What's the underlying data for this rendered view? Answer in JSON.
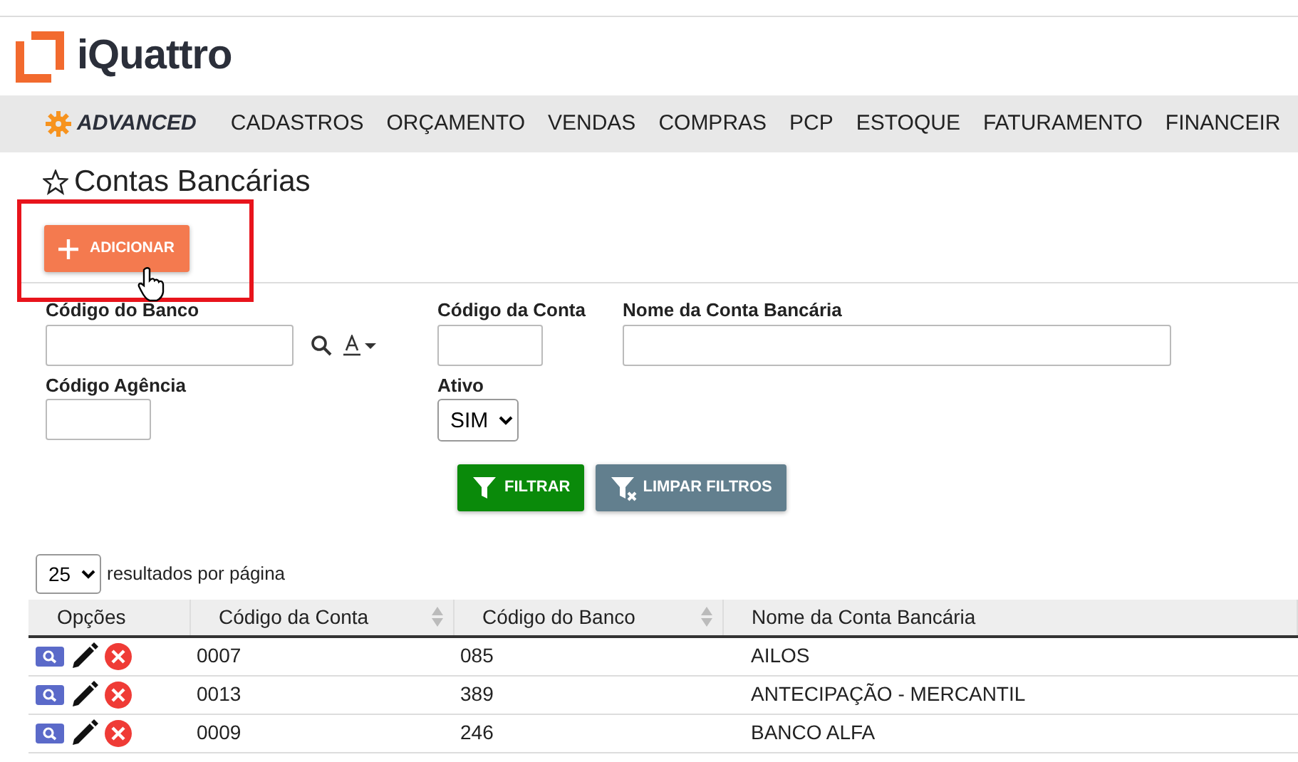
{
  "logo": {
    "text": "iQuattro"
  },
  "nav": {
    "brand": "ADVANCED",
    "items": [
      "CADASTROS",
      "ORÇAMENTO",
      "VENDAS",
      "COMPRAS",
      "PCP",
      "ESTOQUE",
      "FATURAMENTO",
      "FINANCEIR"
    ]
  },
  "page_title": "Contas Bancárias",
  "add_button": "ADICIONAR",
  "filters": [
    {
      "label": "Código do Banco",
      "kind": "lookup"
    },
    {
      "label": "Código da Conta",
      "kind": "short"
    },
    {
      "label": "Nome da Conta Bancária",
      "kind": "long"
    },
    {
      "label": "Código Agência",
      "kind": "short"
    },
    {
      "label": "Ativo",
      "kind": "select",
      "value": "SIM"
    }
  ],
  "filter_buttons": [
    {
      "label": "FILTRAR",
      "kind": "apply"
    },
    {
      "label": "LIMPAR FILTROS",
      "kind": "clear"
    }
  ],
  "page_size": {
    "value": "25",
    "label": "resultados por página"
  },
  "table": {
    "columns": [
      {
        "label": "Opções",
        "sortable": false
      },
      {
        "label": "Código da Conta",
        "sortable": true
      },
      {
        "label": "Código do Banco",
        "sortable": true
      },
      {
        "label": "Nome da Conta Bancária",
        "sortable": false
      }
    ],
    "rows": [
      [
        "",
        "0007",
        "085",
        "AILOS"
      ],
      [
        "",
        "0013",
        "389",
        "ANTECIPAÇÃO - MERCANTIL"
      ],
      [
        "",
        "0009",
        "246",
        "BANCO ALFA"
      ]
    ]
  }
}
